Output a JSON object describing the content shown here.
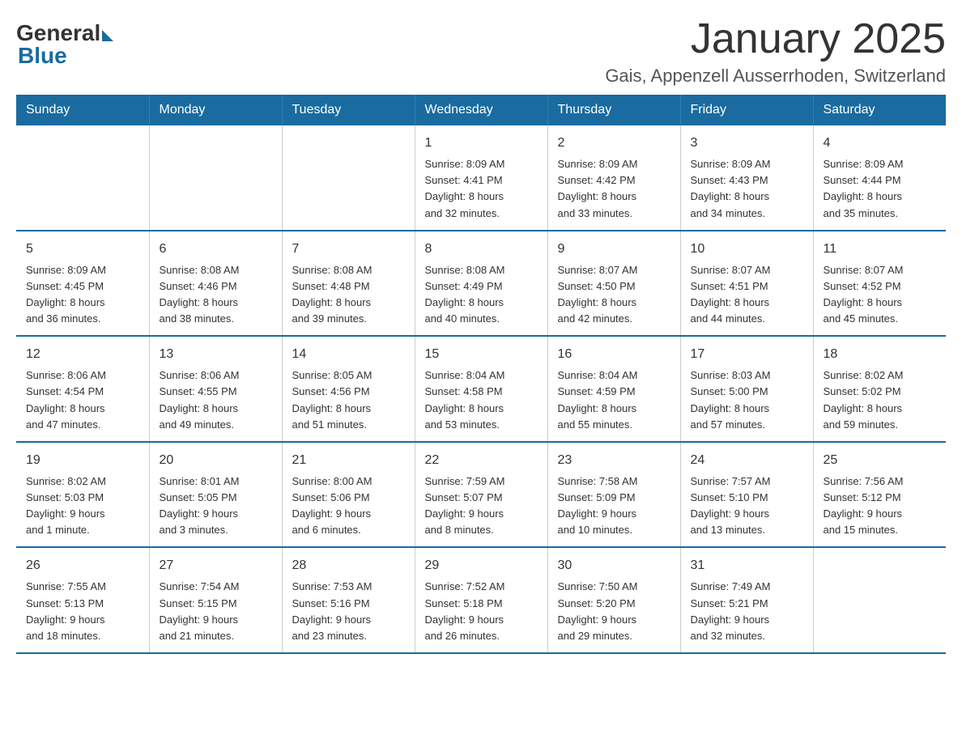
{
  "logo": {
    "general": "General",
    "blue": "Blue"
  },
  "header": {
    "title": "January 2025",
    "subtitle": "Gais, Appenzell Ausserrhoden, Switzerland"
  },
  "days": [
    "Sunday",
    "Monday",
    "Tuesday",
    "Wednesday",
    "Thursday",
    "Friday",
    "Saturday"
  ],
  "weeks": [
    {
      "cells": [
        {
          "day": "",
          "info": ""
        },
        {
          "day": "",
          "info": ""
        },
        {
          "day": "",
          "info": ""
        },
        {
          "day": "1",
          "info": "Sunrise: 8:09 AM\nSunset: 4:41 PM\nDaylight: 8 hours\nand 32 minutes."
        },
        {
          "day": "2",
          "info": "Sunrise: 8:09 AM\nSunset: 4:42 PM\nDaylight: 8 hours\nand 33 minutes."
        },
        {
          "day": "3",
          "info": "Sunrise: 8:09 AM\nSunset: 4:43 PM\nDaylight: 8 hours\nand 34 minutes."
        },
        {
          "day": "4",
          "info": "Sunrise: 8:09 AM\nSunset: 4:44 PM\nDaylight: 8 hours\nand 35 minutes."
        }
      ]
    },
    {
      "cells": [
        {
          "day": "5",
          "info": "Sunrise: 8:09 AM\nSunset: 4:45 PM\nDaylight: 8 hours\nand 36 minutes."
        },
        {
          "day": "6",
          "info": "Sunrise: 8:08 AM\nSunset: 4:46 PM\nDaylight: 8 hours\nand 38 minutes."
        },
        {
          "day": "7",
          "info": "Sunrise: 8:08 AM\nSunset: 4:48 PM\nDaylight: 8 hours\nand 39 minutes."
        },
        {
          "day": "8",
          "info": "Sunrise: 8:08 AM\nSunset: 4:49 PM\nDaylight: 8 hours\nand 40 minutes."
        },
        {
          "day": "9",
          "info": "Sunrise: 8:07 AM\nSunset: 4:50 PM\nDaylight: 8 hours\nand 42 minutes."
        },
        {
          "day": "10",
          "info": "Sunrise: 8:07 AM\nSunset: 4:51 PM\nDaylight: 8 hours\nand 44 minutes."
        },
        {
          "day": "11",
          "info": "Sunrise: 8:07 AM\nSunset: 4:52 PM\nDaylight: 8 hours\nand 45 minutes."
        }
      ]
    },
    {
      "cells": [
        {
          "day": "12",
          "info": "Sunrise: 8:06 AM\nSunset: 4:54 PM\nDaylight: 8 hours\nand 47 minutes."
        },
        {
          "day": "13",
          "info": "Sunrise: 8:06 AM\nSunset: 4:55 PM\nDaylight: 8 hours\nand 49 minutes."
        },
        {
          "day": "14",
          "info": "Sunrise: 8:05 AM\nSunset: 4:56 PM\nDaylight: 8 hours\nand 51 minutes."
        },
        {
          "day": "15",
          "info": "Sunrise: 8:04 AM\nSunset: 4:58 PM\nDaylight: 8 hours\nand 53 minutes."
        },
        {
          "day": "16",
          "info": "Sunrise: 8:04 AM\nSunset: 4:59 PM\nDaylight: 8 hours\nand 55 minutes."
        },
        {
          "day": "17",
          "info": "Sunrise: 8:03 AM\nSunset: 5:00 PM\nDaylight: 8 hours\nand 57 minutes."
        },
        {
          "day": "18",
          "info": "Sunrise: 8:02 AM\nSunset: 5:02 PM\nDaylight: 8 hours\nand 59 minutes."
        }
      ]
    },
    {
      "cells": [
        {
          "day": "19",
          "info": "Sunrise: 8:02 AM\nSunset: 5:03 PM\nDaylight: 9 hours\nand 1 minute."
        },
        {
          "day": "20",
          "info": "Sunrise: 8:01 AM\nSunset: 5:05 PM\nDaylight: 9 hours\nand 3 minutes."
        },
        {
          "day": "21",
          "info": "Sunrise: 8:00 AM\nSunset: 5:06 PM\nDaylight: 9 hours\nand 6 minutes."
        },
        {
          "day": "22",
          "info": "Sunrise: 7:59 AM\nSunset: 5:07 PM\nDaylight: 9 hours\nand 8 minutes."
        },
        {
          "day": "23",
          "info": "Sunrise: 7:58 AM\nSunset: 5:09 PM\nDaylight: 9 hours\nand 10 minutes."
        },
        {
          "day": "24",
          "info": "Sunrise: 7:57 AM\nSunset: 5:10 PM\nDaylight: 9 hours\nand 13 minutes."
        },
        {
          "day": "25",
          "info": "Sunrise: 7:56 AM\nSunset: 5:12 PM\nDaylight: 9 hours\nand 15 minutes."
        }
      ]
    },
    {
      "cells": [
        {
          "day": "26",
          "info": "Sunrise: 7:55 AM\nSunset: 5:13 PM\nDaylight: 9 hours\nand 18 minutes."
        },
        {
          "day": "27",
          "info": "Sunrise: 7:54 AM\nSunset: 5:15 PM\nDaylight: 9 hours\nand 21 minutes."
        },
        {
          "day": "28",
          "info": "Sunrise: 7:53 AM\nSunset: 5:16 PM\nDaylight: 9 hours\nand 23 minutes."
        },
        {
          "day": "29",
          "info": "Sunrise: 7:52 AM\nSunset: 5:18 PM\nDaylight: 9 hours\nand 26 minutes."
        },
        {
          "day": "30",
          "info": "Sunrise: 7:50 AM\nSunset: 5:20 PM\nDaylight: 9 hours\nand 29 minutes."
        },
        {
          "day": "31",
          "info": "Sunrise: 7:49 AM\nSunset: 5:21 PM\nDaylight: 9 hours\nand 32 minutes."
        },
        {
          "day": "",
          "info": ""
        }
      ]
    }
  ]
}
